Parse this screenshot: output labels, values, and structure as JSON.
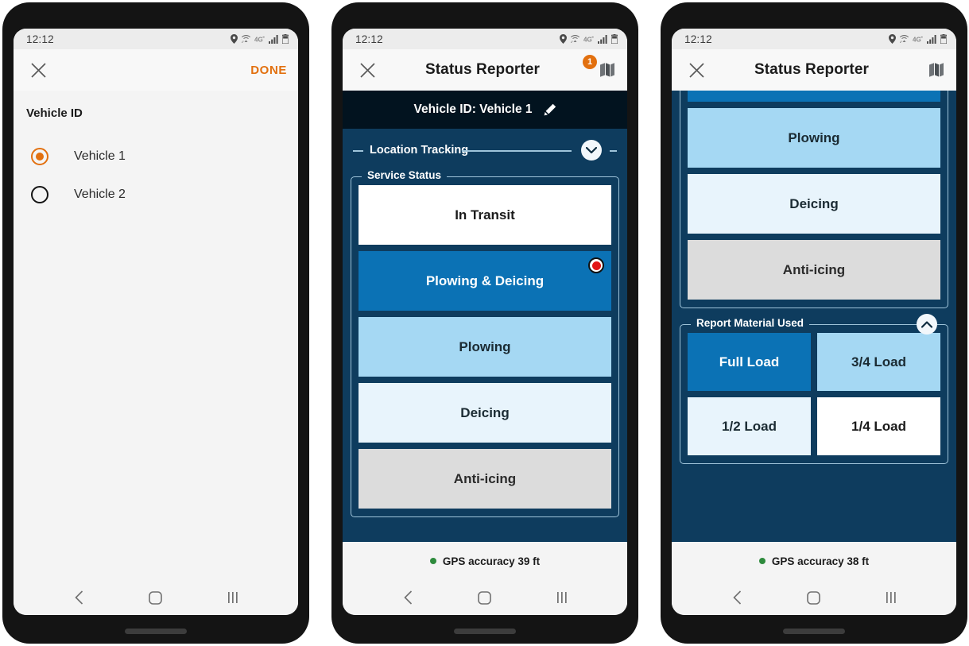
{
  "meta": {
    "colors": {
      "accent_orange": "#e2700f",
      "navy_bg": "#0e3c5e",
      "navy_dark": "#02131f",
      "selected_blue": "#0b72b5",
      "light_blue": "#a5d8f3",
      "pale_blue": "#e8f4fc",
      "gray": "#dcdcdc",
      "white": "#ffffff",
      "gps_green": "#2e8b3d",
      "record_red": "#e21414"
    }
  },
  "statusbar": {
    "time": "12:12",
    "icons": [
      "location-pin-icon",
      "wifi-icon",
      "4g-icon",
      "signal-bars-icon",
      "battery-icon"
    ]
  },
  "navbar": {
    "back": "back-icon",
    "home": "home-icon",
    "recents": "recents-icon"
  },
  "phone1": {
    "toolbar": {
      "close_icon": "close-icon",
      "done_label": "DONE"
    },
    "picker": {
      "label": "Vehicle ID",
      "options": [
        {
          "label": "Vehicle 1",
          "selected": true
        },
        {
          "label": "Vehicle 2",
          "selected": false
        }
      ]
    }
  },
  "phone2": {
    "toolbar": {
      "close_icon": "close-icon",
      "title": "Status Reporter",
      "map_icon": "map-icon",
      "badge_count": "1"
    },
    "vehicle_bar": {
      "text": "Vehicle ID: Vehicle 1",
      "edit_icon": "pencil-icon"
    },
    "location_tracking": {
      "label": "Location Tracking",
      "state": "collapsed",
      "toggle_icon": "chevron-down-icon"
    },
    "service_status": {
      "legend": "Service Status",
      "buttons": [
        {
          "label": "In Transit",
          "style": "white",
          "selected": false
        },
        {
          "label": "Plowing & Deicing",
          "style": "selected",
          "selected": true
        },
        {
          "label": "Plowing",
          "style": "light-blue",
          "selected": false
        },
        {
          "label": "Deicing",
          "style": "pale-blue",
          "selected": false
        },
        {
          "label": "Anti-icing",
          "style": "gray",
          "selected": false
        }
      ]
    },
    "gps": {
      "text": "GPS accuracy 39 ft",
      "status": "good"
    }
  },
  "phone3": {
    "toolbar": {
      "close_icon": "close-icon",
      "title": "Status Reporter",
      "map_icon": "map-icon"
    },
    "service_status": {
      "buttons": [
        {
          "label": "",
          "style": "selected",
          "selected": true,
          "clipped": true
        },
        {
          "label": "Plowing",
          "style": "light-blue",
          "selected": false
        },
        {
          "label": "Deicing",
          "style": "pale-blue",
          "selected": false
        },
        {
          "label": "Anti-icing",
          "style": "gray",
          "selected": false
        }
      ]
    },
    "report_material": {
      "legend": "Report Material Used",
      "state": "expanded",
      "toggle_icon": "chevron-up-icon",
      "buttons": [
        {
          "label": "Full Load",
          "style": "selected",
          "selected": true
        },
        {
          "label": "3/4 Load",
          "style": "light-blue",
          "selected": false
        },
        {
          "label": "1/2 Load",
          "style": "pale-blue",
          "selected": false
        },
        {
          "label": "1/4 Load",
          "style": "white",
          "selected": false
        }
      ]
    },
    "gps": {
      "text": "GPS accuracy 38 ft",
      "status": "good"
    }
  }
}
